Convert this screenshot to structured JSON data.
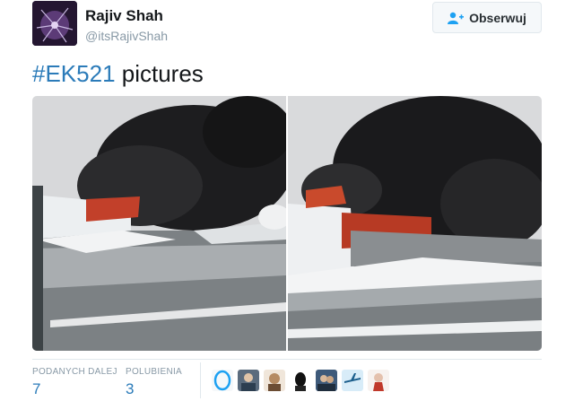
{
  "author": {
    "name": "Rajiv Shah",
    "handle": "@itsRajivShah"
  },
  "follow_button": {
    "label": "Obserwuj",
    "icon": "follow-person-plus-icon"
  },
  "tweet": {
    "hashtag": "#EK521",
    "text": " pictures"
  },
  "media": {
    "photos": [
      "burning-aircraft-photo-left",
      "burning-aircraft-photo-right"
    ]
  },
  "stats": {
    "retweets_label": "PODANYCH DALEJ",
    "retweets_value": "7",
    "likes_label": "POLUBIENIA",
    "likes_value": "3"
  },
  "likers": [
    "liker-avatar-1",
    "liker-avatar-2",
    "liker-avatar-3",
    "liker-avatar-4",
    "liker-avatar-5",
    "liker-avatar-6",
    "liker-avatar-7"
  ],
  "colors": {
    "link": "#2b7bb9",
    "muted": "#8899a6",
    "text": "#14171a"
  }
}
